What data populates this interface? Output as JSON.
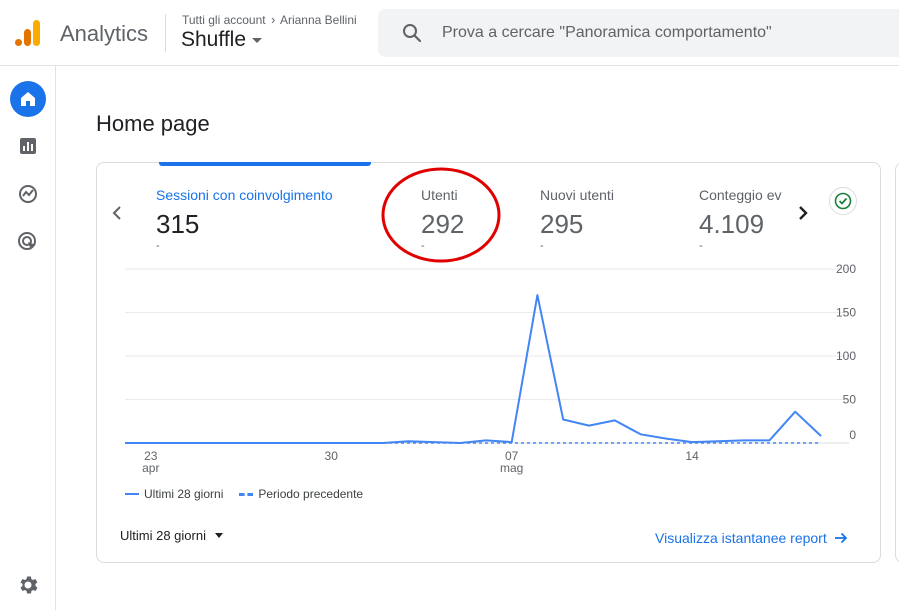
{
  "header": {
    "app_name": "Analytics",
    "breadcrumb_all_accounts": "Tutti gli account",
    "breadcrumb_account": "Arianna Bellini",
    "property_name": "Shuffle",
    "search_placeholder": "Prova a cercare \"Panoramica comportamento\""
  },
  "colors": {
    "brand_orange": "#f9ab00",
    "brand_dark_orange": "#e37400",
    "accent_blue": "#1a73e8",
    "series_blue": "#4285f4",
    "annotation_red": "#e00000",
    "check_green": "#188038"
  },
  "nav": {
    "items": [
      {
        "icon": "home-icon",
        "active": true
      },
      {
        "icon": "reports-icon",
        "active": false
      },
      {
        "icon": "explore-icon",
        "active": false
      },
      {
        "icon": "advertising-icon",
        "active": false
      }
    ],
    "settings_icon": "settings-icon"
  },
  "page": {
    "title": "Home page"
  },
  "metrics": [
    {
      "label": "Sessioni con coinvolgimento",
      "value": "315",
      "delta": "-",
      "active": true
    },
    {
      "label": "Utenti",
      "value": "292",
      "delta": "-",
      "active": false
    },
    {
      "label": "Nuovi utenti",
      "value": "295",
      "delta": "-",
      "active": false
    },
    {
      "label": "Conteggio ev",
      "value": "4.109",
      "delta": "-",
      "active": false
    }
  ],
  "chart_data": {
    "type": "line",
    "x": [
      "22 apr",
      "23 apr",
      "24 apr",
      "25 apr",
      "26 apr",
      "27 apr",
      "28 apr",
      "29 apr",
      "30 apr",
      "1 mag",
      "2 mag",
      "3 mag",
      "4 mag",
      "5 mag",
      "6 mag",
      "7 mag",
      "8 mag",
      "9 mag",
      "10 mag",
      "11 mag",
      "12 mag",
      "13 mag",
      "14 mag",
      "15 mag",
      "16 mag",
      "17 mag",
      "18 mag",
      "19 mag"
    ],
    "x_tick_labels": [
      {
        "label": "23",
        "sub": "apr",
        "index": 1
      },
      {
        "label": "30",
        "sub": "",
        "index": 8
      },
      {
        "label": "07",
        "sub": "mag",
        "index": 15
      },
      {
        "label": "14",
        "sub": "",
        "index": 22
      }
    ],
    "series": [
      {
        "name": "Ultimi 28 giorni",
        "style": "solid",
        "values": [
          0,
          0,
          0,
          0,
          0,
          0,
          0,
          0,
          0,
          0,
          0,
          2,
          1,
          0,
          3,
          1,
          170,
          27,
          20,
          26,
          10,
          5,
          1,
          2,
          3,
          3,
          36,
          8
        ]
      },
      {
        "name": "Periodo precedente",
        "style": "dashed",
        "values": [
          0,
          0,
          0,
          0,
          0,
          0,
          0,
          0,
          0,
          0,
          0,
          0,
          0,
          0,
          0,
          0,
          0,
          0,
          0,
          0,
          0,
          0,
          0,
          0,
          0,
          0,
          0,
          0
        ]
      }
    ],
    "y_ticks": [
      "200",
      "150",
      "100",
      "50",
      "0"
    ],
    "ylim": [
      0,
      200
    ],
    "grid": true,
    "legend_position": "bottom-left"
  },
  "footer": {
    "period_selector": "Ultimi 28 giorni",
    "report_link": "Visualizza istantanee report"
  }
}
